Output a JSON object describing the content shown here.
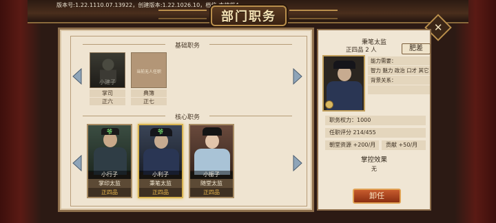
{
  "header": {
    "version_info": "版本号:1.22.1110.07.13922，创建版本:1.22.1026.10，档位:本地档4",
    "title": "部门职务",
    "close_icon": "close-diamond-icon"
  },
  "basic_section": {
    "title": "基础职务",
    "slots": [
      {
        "character": "小建子",
        "post": "掌司",
        "rank": "正六",
        "empty_text": ""
      },
      {
        "character": "",
        "post": "典簿",
        "rank": "正七",
        "empty_text": "当前无人任职"
      }
    ]
  },
  "core_section": {
    "title": "核心职务",
    "slots": [
      {
        "badge": "爷",
        "character": "小行子",
        "post": "掌印太监",
        "rank": "正四品",
        "selected": false
      },
      {
        "badge": "爷",
        "character": "小利子",
        "post": "秉笔太监",
        "rank": "正四品",
        "selected": true
      },
      {
        "badge": "",
        "character": "小振子",
        "post": "随堂太监",
        "rank": "正四品",
        "selected": false
      }
    ]
  },
  "detail": {
    "post_title": "秉笔太监",
    "rank_count": "正四品 2 人",
    "perk_button": "肥差",
    "requirements_label": "能力需要：",
    "requirements_values": "智力 魅力 政治 口才 其它",
    "background_label": "背景关系：",
    "power": "职务权力：1000",
    "score": "任职评分  214/455",
    "resource": "朝堂资源 +200/月",
    "contribution": "贡献  +50/月",
    "control_title": "掌控效果",
    "control_value": "无",
    "dismiss_button": "卸任"
  },
  "colors": {
    "accent_gold": "#d7b250",
    "rank_text": "#e8b64d",
    "dismiss_red": "#b24a20"
  }
}
